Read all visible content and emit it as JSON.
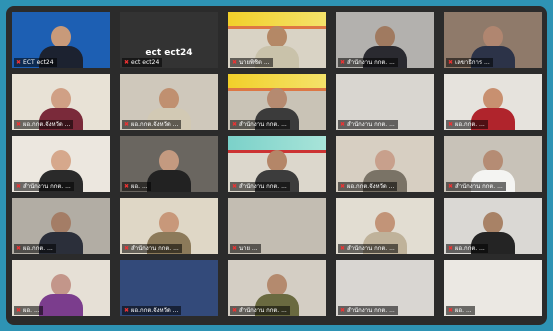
{
  "meeting": {
    "tiles": [
      {
        "id": "t1",
        "name": "ECT ect24",
        "center_text": "",
        "bg": "#1d5fb3",
        "banner": "",
        "person": true,
        "skin": "#c89a7a",
        "shirt": "#1c2230",
        "active": true
      },
      {
        "id": "t2",
        "name": "ect ect24",
        "center_text": "ect ect24",
        "bg": "#333333",
        "banner": "",
        "person": false,
        "skin": "",
        "shirt": "",
        "active": false
      },
      {
        "id": "t3",
        "name": "นายพิชิต ...",
        "center_text": "",
        "bg": "#d9d3c5",
        "banner": "yellow",
        "person": true,
        "skin": "#b48866",
        "shirt": "#c9c2aa",
        "active": false
      },
      {
        "id": "t4",
        "name": "สำนักงาน กกต. ...",
        "center_text": "",
        "bg": "#b3b1ae",
        "banner": "",
        "person": true,
        "skin": "#a07a60",
        "shirt": "#2a2a30",
        "active": false
      },
      {
        "id": "t5",
        "name": "เลขาธิการ ...",
        "center_text": "",
        "bg": "#8f7a6a",
        "banner": "",
        "person": true,
        "skin": "#b08670",
        "shirt": "#2c3348",
        "active": false
      },
      {
        "id": "t6",
        "name": "ผอ.กกต.จังหวัด ...",
        "center_text": "",
        "bg": "#e8e2d6",
        "banner": "",
        "person": true,
        "skin": "#d0a085",
        "shirt": "#7a2a3a",
        "active": false
      },
      {
        "id": "t7",
        "name": "ผอ.กกต.จังหวัด ...",
        "center_text": "",
        "bg": "#cfc8bb",
        "banner": "",
        "person": true,
        "skin": "#c09070",
        "shirt": "#d2c9b4",
        "active": false
      },
      {
        "id": "t8",
        "name": "สำนักงาน กกต. ...",
        "center_text": "",
        "bg": "#c9c3b6",
        "banner": "yellow",
        "person": true,
        "skin": "#b58a70",
        "shirt": "#3b3b3b",
        "active": false
      },
      {
        "id": "t9",
        "name": "สำนักงาน กกต. ...",
        "center_text": "",
        "bg": "#d9d6d0",
        "banner": "",
        "person": false,
        "skin": "",
        "shirt": "",
        "active": false
      },
      {
        "id": "t10",
        "name": "ผอ.กกต. ...",
        "center_text": "",
        "bg": "#e6e3dd",
        "banner": "",
        "person": true,
        "skin": "#c89070",
        "shirt": "#b0242c",
        "active": false
      },
      {
        "id": "t11",
        "name": "สำนักงาน กกต. ...",
        "center_text": "",
        "bg": "#ece7df",
        "banner": "",
        "person": true,
        "skin": "#d6a88c",
        "shirt": "#2a2a2a",
        "active": false
      },
      {
        "id": "t12",
        "name": "ผอ. ...",
        "center_text": "",
        "bg": "#6a6660",
        "banner": "",
        "person": true,
        "skin": "#c49a80",
        "shirt": "#222",
        "active": false
      },
      {
        "id": "t13",
        "name": "สำนักงาน กกต. ...",
        "center_text": "",
        "bg": "#dcd7cc",
        "banner": "teal",
        "person": true,
        "skin": "#b48668",
        "shirt": "#3c3c3c",
        "active": false
      },
      {
        "id": "t14",
        "name": "ผอ.กกต.จังหวัด ...",
        "center_text": "",
        "bg": "#d7cfc2",
        "banner": "",
        "person": true,
        "skin": "#c8a08c",
        "shirt": "#7a7366",
        "active": false
      },
      {
        "id": "t15",
        "name": "สำนักงาน กกต. ...",
        "center_text": "",
        "bg": "#c8c2b8",
        "banner": "",
        "person": true,
        "skin": "#b58c74",
        "shirt": "#f4f4f2",
        "active": false
      },
      {
        "id": "t16",
        "name": "ผอ.กกต. ...",
        "center_text": "",
        "bg": "#b2ada4",
        "banner": "",
        "person": true,
        "skin": "#a47d66",
        "shirt": "#2b2f3a",
        "active": false
      },
      {
        "id": "t17",
        "name": "สำนักงาน กกต. ...",
        "center_text": "",
        "bg": "#dfd7c6",
        "banner": "",
        "person": true,
        "skin": "#c8987a",
        "shirt": "#8c7a5a",
        "active": false
      },
      {
        "id": "t18",
        "name": "นาย ...",
        "center_text": "",
        "bg": "#c3bdb2",
        "banner": "",
        "person": false,
        "skin": "",
        "shirt": "",
        "active": false
      },
      {
        "id": "t19",
        "name": "สำนักงาน กกต. ...",
        "center_text": "",
        "bg": "#e2ddd2",
        "banner": "",
        "person": true,
        "skin": "#c29478",
        "shirt": "#bfb29a",
        "active": false
      },
      {
        "id": "t20",
        "name": "ผอ.กกต. ...",
        "center_text": "",
        "bg": "#dad8d4",
        "banner": "",
        "person": true,
        "skin": "#a88266",
        "shirt": "#242424",
        "active": false
      },
      {
        "id": "t21",
        "name": "ผอ. ...",
        "center_text": "",
        "bg": "#e6e0d6",
        "banner": "",
        "person": true,
        "skin": "#c3968a",
        "shirt": "#7b3d8d",
        "active": false
      },
      {
        "id": "t22",
        "name": "ผอ.กกต.จังหวัด ...",
        "center_text": "",
        "bg": "#334a7a",
        "banner": "",
        "person": false,
        "skin": "",
        "shirt": "",
        "active": false
      },
      {
        "id": "t23",
        "name": "สำนักงาน กกต. ...",
        "center_text": "",
        "bg": "#d4cec4",
        "banner": "",
        "person": true,
        "skin": "#b48a6e",
        "shirt": "#6a6a40",
        "active": false
      },
      {
        "id": "t24",
        "name": "สำนักงาน กกต. ...",
        "center_text": "",
        "bg": "#d9d6d2",
        "banner": "",
        "person": false,
        "skin": "",
        "shirt": "",
        "active": false
      },
      {
        "id": "t25",
        "name": "ผอ. ...",
        "center_text": "",
        "bg": "#ebe8e3",
        "banner": "",
        "person": false,
        "skin": "",
        "shirt": "",
        "active": false
      }
    ]
  }
}
